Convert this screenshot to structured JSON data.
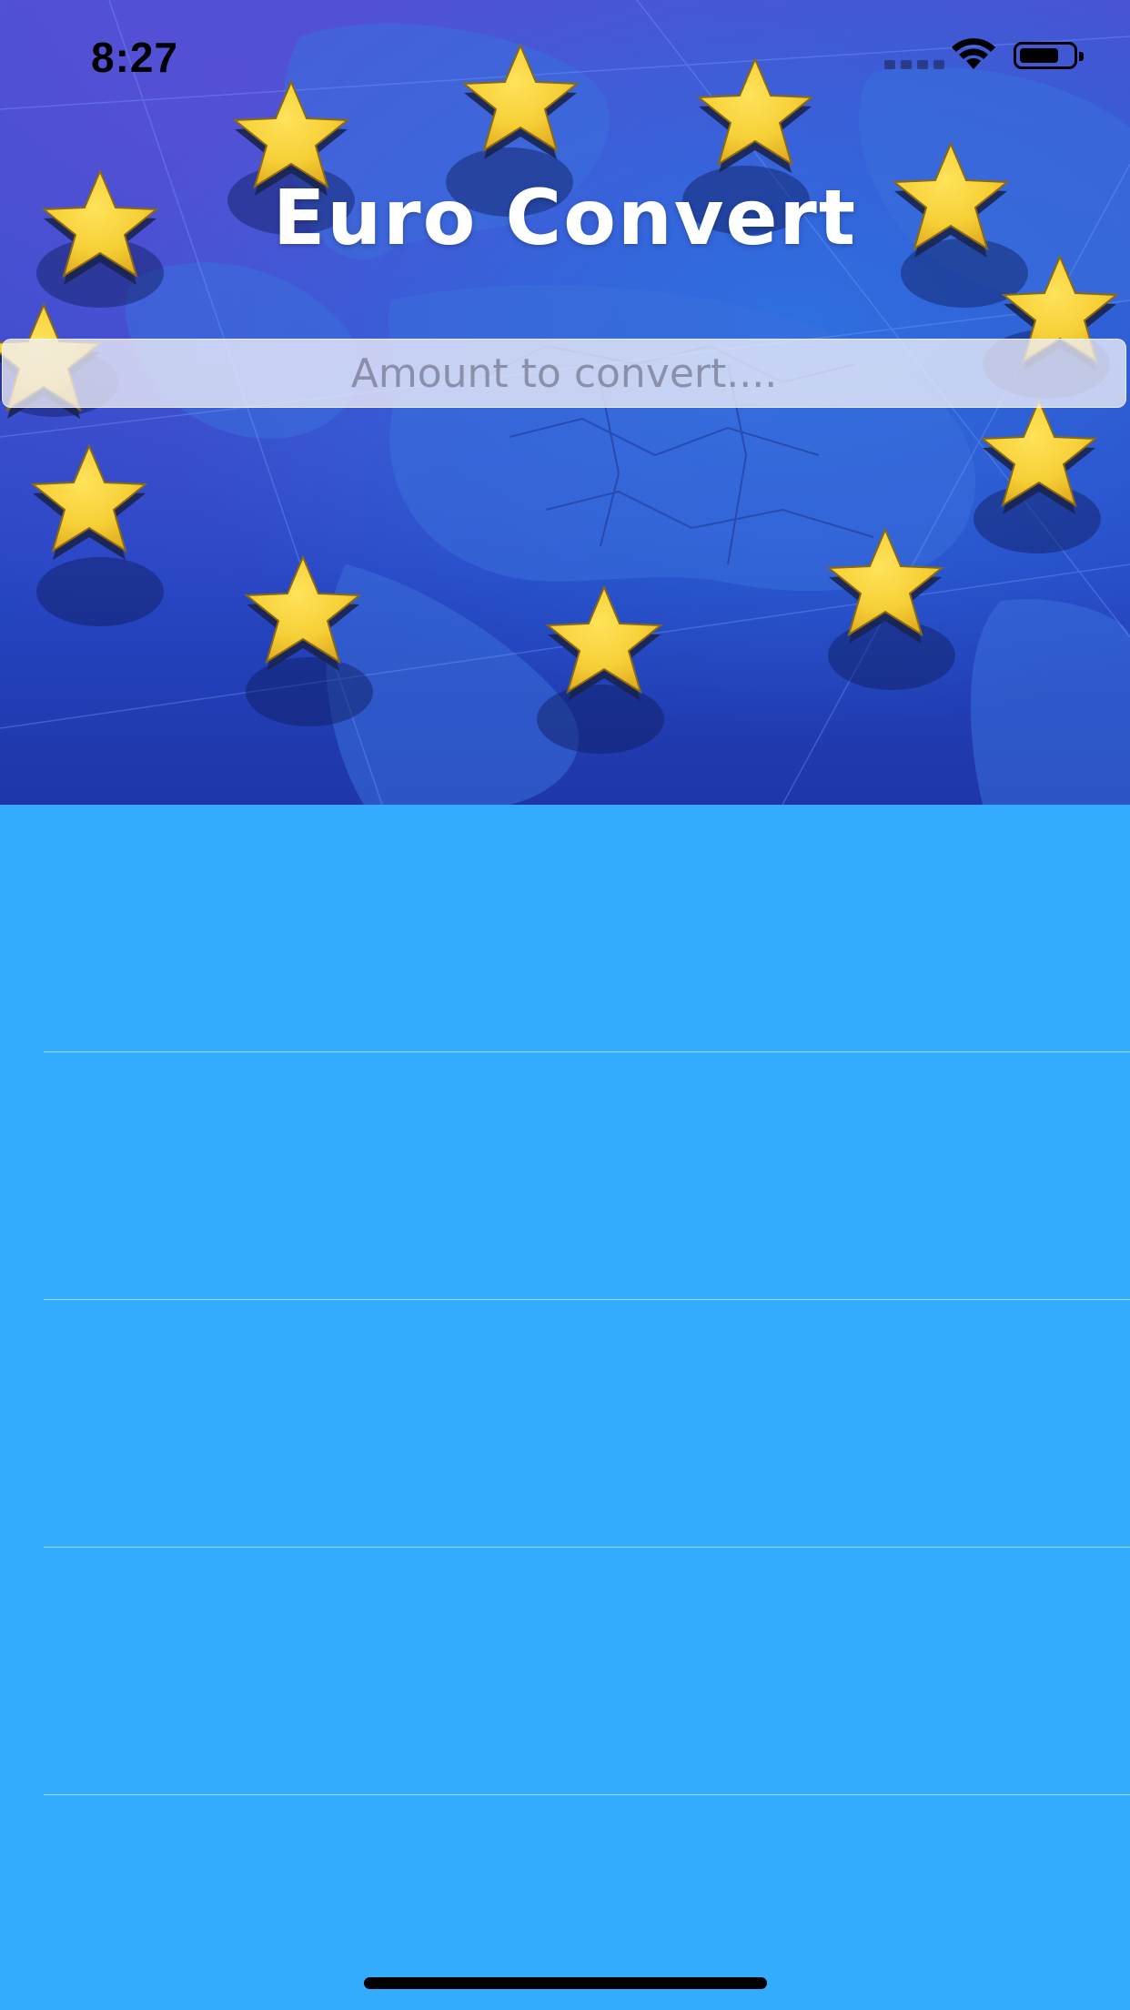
{
  "status_bar": {
    "time": "8:27"
  },
  "app": {
    "title": "Euro Convert"
  },
  "amount_input": {
    "value": "",
    "placeholder": "Amount to convert...."
  },
  "rates_list": {
    "rows": [
      "",
      "",
      "",
      "",
      ""
    ]
  },
  "colors": {
    "list_background": "#33acfe",
    "star": "#f6cf36",
    "hero_blue": "#2c4fcf"
  },
  "icons": [
    "cellular-signal-icon",
    "wifi-icon",
    "battery-icon"
  ]
}
